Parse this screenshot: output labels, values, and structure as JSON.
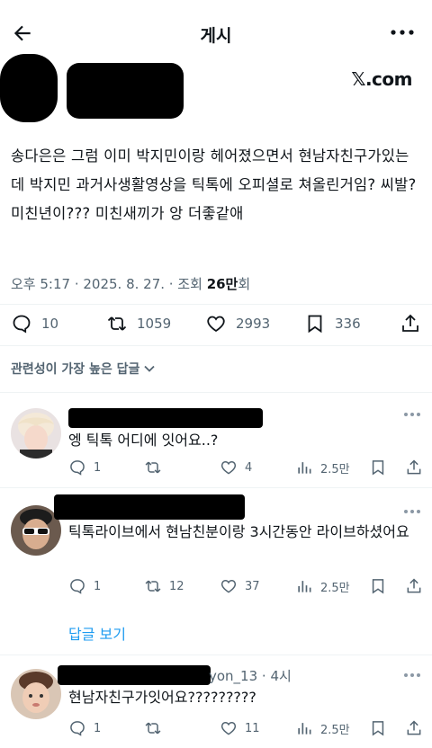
{
  "header": {
    "title": "게시"
  },
  "post": {
    "source": "𝕏.com",
    "text": "송다은은 그럼 이미 박지민이랑 헤어졌으면서 현남자친구가있는데 박지민 과거사생활영상을 틱톡에 오피셜로 쳐올린거임? 씨발? 미친년이??? 미친새끼가 앙 더좋같애",
    "time": "오후 5:17 · 2025. 8. 27. · 조회 ",
    "views": "26만",
    "views_suffix": "회",
    "replies": "10",
    "reposts": "1059",
    "likes": "2993",
    "bookmarks": "336"
  },
  "replies_sort": "관련성이 가장 높은 답글",
  "replies": [
    {
      "text": "엥 틱톡 어디에 잇어요..?",
      "replies": "1",
      "reposts": "",
      "likes": "4",
      "views": "2.5만"
    },
    {
      "text": "틱톡라이브에서 현남친분이랑 3시간동안 라이브하셨어요",
      "replies": "1",
      "reposts": "12",
      "likes": "37",
      "views": "2.5만"
    },
    {
      "text": "현남자친구가잇어요?????????",
      "replies": "1",
      "reposts": "",
      "likes": "11",
      "views": "2.5만",
      "header_partial": "yon_13 · 4시"
    }
  ],
  "show_replies_label": "답글 보기",
  "colors": {
    "link": "#1d9bf0",
    "muted": "#536471",
    "text": "#0f1419"
  }
}
